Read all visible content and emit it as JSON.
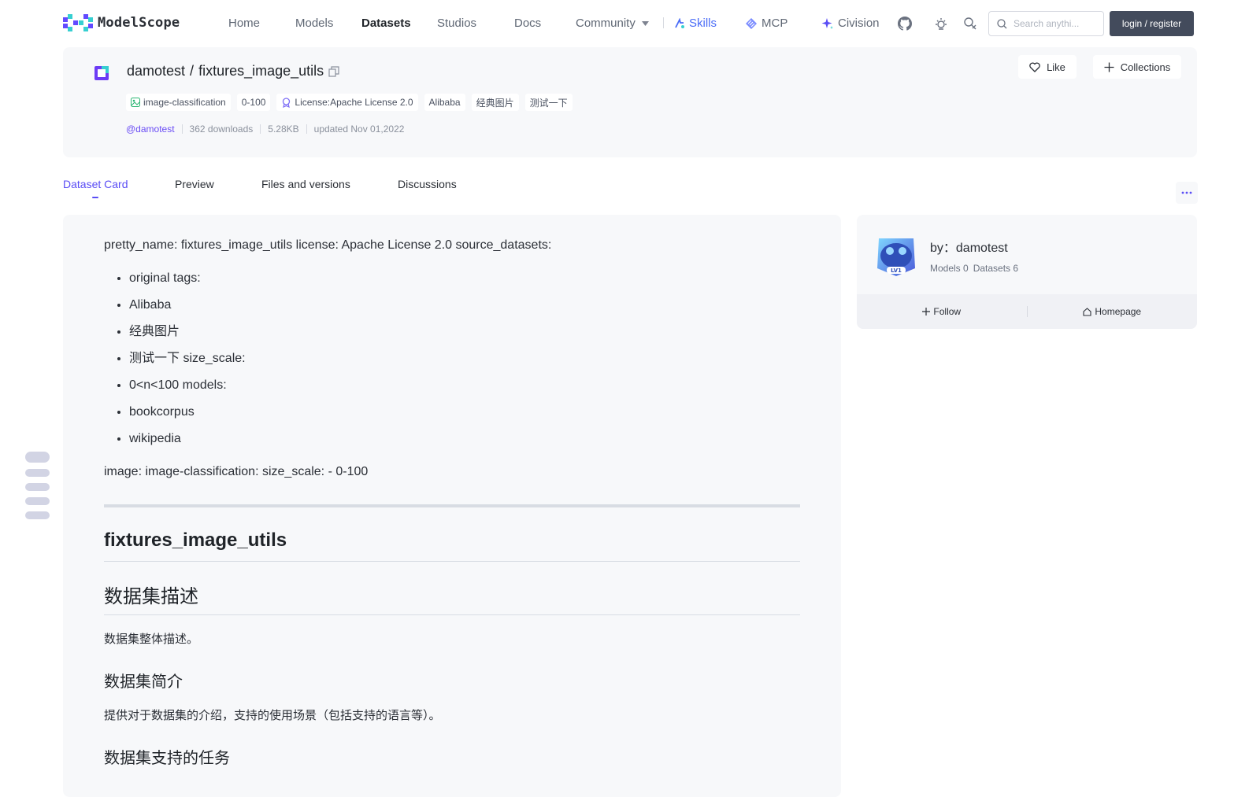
{
  "nav": {
    "logo_text": "ModelScope",
    "items": [
      {
        "label": "Home"
      },
      {
        "label": "Models"
      },
      {
        "label": "Datasets"
      },
      {
        "label": "Studios"
      },
      {
        "label": "Docs"
      },
      {
        "label": "Community"
      }
    ],
    "skills_label": "Skills",
    "mcp_label": "MCP",
    "civision_label": "Civision",
    "search_placeholder": "Search anythi...",
    "login_label": "login / register"
  },
  "dataset": {
    "owner": "damotest",
    "separator": "/",
    "name": "fixtures_image_utils",
    "tags": [
      {
        "label": "image-classification",
        "icon": "image-icon"
      },
      {
        "label": "0-100"
      },
      {
        "label": "License:Apache License 2.0",
        "icon": "license-icon"
      },
      {
        "label": "Alibaba"
      },
      {
        "label": "经典图片"
      },
      {
        "label": "测试一下"
      }
    ],
    "author": "@damotest",
    "downloads": "362 downloads",
    "size": "5.28KB",
    "updated": "updated Nov 01,2022",
    "like_label": "Like",
    "collections_label": "Collections"
  },
  "tabs": [
    {
      "label": "Dataset Card"
    },
    {
      "label": "Preview"
    },
    {
      "label": "Files and versions"
    },
    {
      "label": "Discussions"
    }
  ],
  "card": {
    "intro": "pretty_name: fixtures_image_utils license: Apache License 2.0 source_datasets:",
    "list": [
      "original tags:",
      "Alibaba",
      "经典图片",
      "测试一下 size_scale:",
      "0<n<100 models:",
      "bookcorpus",
      "wikipedia"
    ],
    "image_line": "image: image-classification: size_scale: - 0-100",
    "h1": "fixtures_image_utils",
    "h2": "数据集描述",
    "desc": "数据集整体描述。",
    "h3_intro": "数据集简介",
    "intro_text": "提供对于数据集的介绍，支持的使用场景（包括支持的语言等）。",
    "h3_tasks": "数据集支持的任务"
  },
  "author_card": {
    "by": "by：damotest",
    "models": "Models 0",
    "datasets": "Datasets 6",
    "level": "LV1",
    "follow_label": "Follow",
    "homepage_label": "Homepage"
  },
  "colors": {
    "accent": "#5a4df5",
    "author": "#6a4cf5",
    "login_bg": "#434b5c",
    "card_bg": "#f7f8fa"
  }
}
